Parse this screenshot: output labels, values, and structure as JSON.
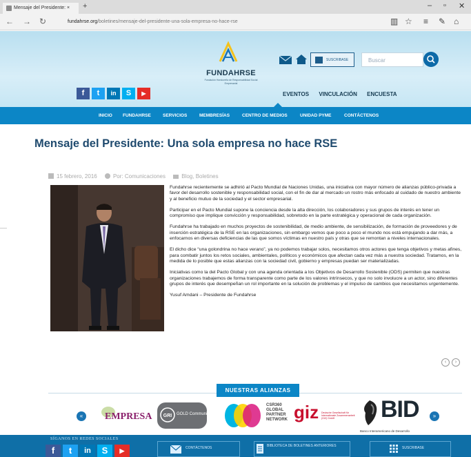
{
  "browser": {
    "tab_title": "Mensaje del Presidente: ×",
    "url_domain": "fundahrse.org",
    "url_path": "/boletines/mensaje-del-presidente-una-sola-empresa-no-hace-rse"
  },
  "header": {
    "logo_name": "FUNDAHRSE",
    "logo_sub": "Fundación Hondureña de Responsabilidad Social Empresarial",
    "subscribe_label": "SUSCRIBASE",
    "search_placeholder": "Buscar",
    "top_links": [
      "EVENTOS",
      "VINCULACIÓN",
      "ENCUESTA"
    ]
  },
  "nav": {
    "items": [
      "INICIO",
      "FUNDAHRSE",
      "SERVICIOS",
      "MEMBRESÍAS",
      "CENTRO DE MEDIOS",
      "UNIDAD PYME",
      "CONTÁCTENOS"
    ]
  },
  "article": {
    "title": "Mensaje del Presidente: Una sola empresa no hace RSE",
    "date": "15 febrero, 2016",
    "author": "Por: Comunicaciones",
    "categories": "Blog, Boletines",
    "paragraphs": [
      "Fundahrse recientemente se adhirió al Pacto Mundial de Naciones Unidas, una iniciativa con mayor número de alianzas público-privada a favor del desarrollo sostenible y responsabilidad social, con el fin de dar al mercado un rostro más enfocado al cuidado de nuestro ambiente y al beneficio mutuo de la sociedad y el sector empresarial.",
      "Participar en el Pacto Mundial supone la conciencia desde la alta dirección, los colaboradores y sus grupos de interés en tener un compromiso que implique convicción y responsabilidad, sobretodo en la parte estratégica y operacional de cada organización.",
      "Fundahrse ha trabajado en muchos proyectos de sostenibilidad, de medio ambiente, de sensibilización, de formación de proveedores y de inserción estratégica de la RSE en las organizaciones, sin embargo vemos que poco a poco el mundo nos está empujando a dar más, a enfocarnos en diversas deficiencias de las que somos víctimas en nuestro país y otras que se remontan a niveles internacionales.",
      "El dicho dice “una golondrina no hace verano”, ya no podemos trabajar solos, necesitamos otros actores que tenga objetivos y metas afines, para combatir juntos los retos sociales, ambientales, políticos y económicos que afectan cada vez más a nuestra sociedad. Tratamos, en la medida de lo posible que estas alianzas con la sociedad civil, gobierno y empresas puedan ser materializadas.",
      "Iniciativas como la del Pacto Global y con una agenda orientada a los Objetivos de Desarrollo Sostenible (ODS) permiten que nuestras organizaciones trabajemos de forma transparente como parte de los valores intrínsecos, y que no solo involucre a un actor, sino diferentes grupos de interés que desempeñan un rol importante en la solución de problemas y el impulso de cambios que necesitamos urgentemente.",
      "Yusuf Amdani – Presidente de Fundahrse"
    ]
  },
  "alliances": {
    "title": "NUESTRAS ALIANZAS",
    "empresa": "EMPRESA",
    "gold": "GOLD Community",
    "csr": "CSR360 GLOBAL PARTNER NETWORK",
    "giz": "giz",
    "giz_sub": "Deutsche Gesellschaft für Internationale Zusammenarbeit (GIZ) GmbH",
    "bid": "BID",
    "bid_sub": "Banco Interamericano de Desarrollo"
  },
  "footer": {
    "social_label": "SÍGANOS EN REDES SOCIALES",
    "contact": "CONTÁCTENOS",
    "library": "BIBLIOTECA DE BOLETINES ANTERIORES",
    "subscribe": "SUSCRIBASE"
  },
  "colors": {
    "nav_blue": "#0c86c6",
    "title_blue": "#1f4a6e",
    "facebook": "#3b5998",
    "twitter": "#1da1f2",
    "linkedin": "#0077b5",
    "skype": "#00aff0",
    "youtube": "#e52d27"
  }
}
